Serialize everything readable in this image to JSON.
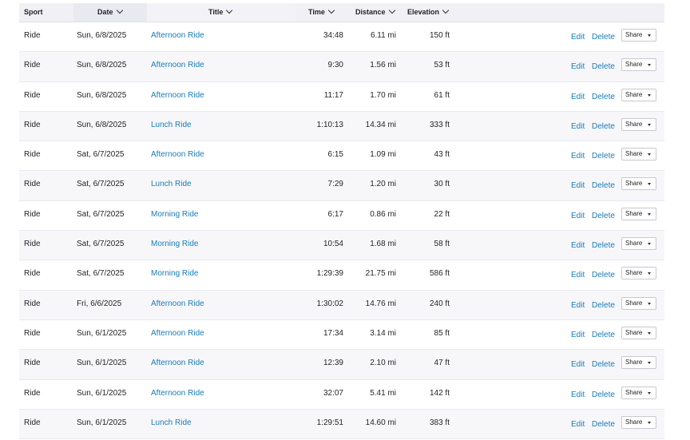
{
  "headers": {
    "sport": "Sport",
    "date": "Date",
    "title": "Title",
    "time": "Time",
    "distance": "Distance",
    "elevation": "Elevation"
  },
  "actions": {
    "edit": "Edit",
    "delete": "Delete",
    "share": "Share"
  },
  "rows": [
    {
      "sport": "Ride",
      "date": "Sun, 6/8/2025",
      "title": "Afternoon Ride",
      "time": "34:48",
      "distance": "6.11 mi",
      "elevation": "150 ft"
    },
    {
      "sport": "Ride",
      "date": "Sun, 6/8/2025",
      "title": "Afternoon Ride",
      "time": "9:30",
      "distance": "1.56 mi",
      "elevation": "53 ft"
    },
    {
      "sport": "Ride",
      "date": "Sun, 6/8/2025",
      "title": "Afternoon Ride",
      "time": "11:17",
      "distance": "1.70 mi",
      "elevation": "61 ft"
    },
    {
      "sport": "Ride",
      "date": "Sun, 6/8/2025",
      "title": "Lunch Ride",
      "time": "1:10:13",
      "distance": "14.34 mi",
      "elevation": "333 ft"
    },
    {
      "sport": "Ride",
      "date": "Sat, 6/7/2025",
      "title": "Afternoon Ride",
      "time": "6:15",
      "distance": "1.09 mi",
      "elevation": "43 ft"
    },
    {
      "sport": "Ride",
      "date": "Sat, 6/7/2025",
      "title": "Lunch Ride",
      "time": "7:29",
      "distance": "1.20 mi",
      "elevation": "30 ft"
    },
    {
      "sport": "Ride",
      "date": "Sat, 6/7/2025",
      "title": "Morning Ride",
      "time": "6:17",
      "distance": "0.86 mi",
      "elevation": "22 ft"
    },
    {
      "sport": "Ride",
      "date": "Sat, 6/7/2025",
      "title": "Morning Ride",
      "time": "10:54",
      "distance": "1.68 mi",
      "elevation": "58 ft"
    },
    {
      "sport": "Ride",
      "date": "Sat, 6/7/2025",
      "title": "Morning Ride",
      "time": "1:29:39",
      "distance": "21.75 mi",
      "elevation": "586 ft"
    },
    {
      "sport": "Ride",
      "date": "Fri, 6/6/2025",
      "title": "Afternoon Ride",
      "time": "1:30:02",
      "distance": "14.76 mi",
      "elevation": "240 ft"
    },
    {
      "sport": "Ride",
      "date": "Sun, 6/1/2025",
      "title": "Afternoon Ride",
      "time": "17:34",
      "distance": "3.14 mi",
      "elevation": "85 ft"
    },
    {
      "sport": "Ride",
      "date": "Sun, 6/1/2025",
      "title": "Afternoon Ride",
      "time": "12:39",
      "distance": "2.10 mi",
      "elevation": "47 ft"
    },
    {
      "sport": "Ride",
      "date": "Sun, 6/1/2025",
      "title": "Afternoon Ride",
      "time": "32:07",
      "distance": "5.41 mi",
      "elevation": "142 ft"
    },
    {
      "sport": "Ride",
      "date": "Sun, 6/1/2025",
      "title": "Lunch Ride",
      "time": "1:29:51",
      "distance": "14.60 mi",
      "elevation": "383 ft"
    }
  ],
  "colors": {
    "link": "#1a7cb6",
    "header_bg": "#f0f0f5",
    "row_alt_bg": "#f7f7fa"
  },
  "icons": {
    "sort": "chevron-down-icon",
    "share_caret": "caret-down-icon"
  }
}
